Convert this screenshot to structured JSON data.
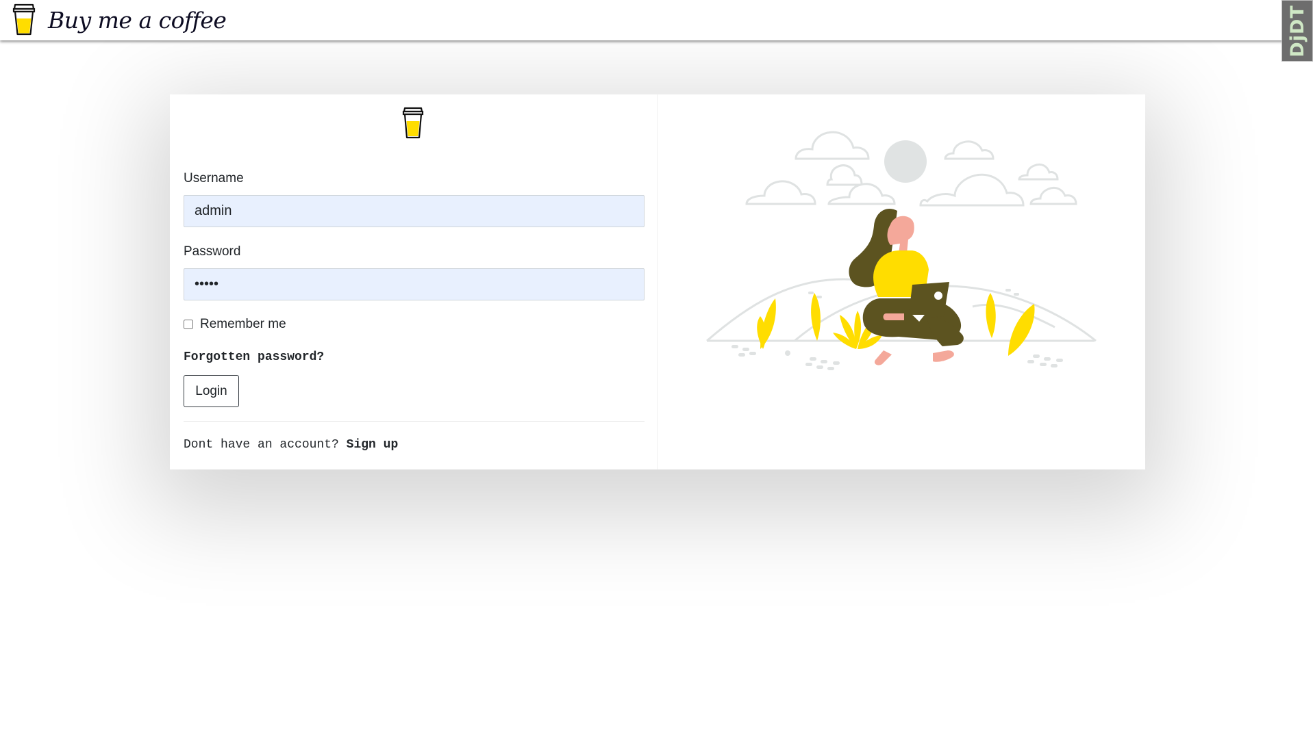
{
  "navbar": {
    "brand_text": "Buy me a coffee",
    "logo_icon": "coffee-cup-icon"
  },
  "debug_toolbar": {
    "label": "DjDT"
  },
  "login_form": {
    "logo_icon": "coffee-cup-icon",
    "username_label": "Username",
    "username_value": "admin",
    "password_label": "Password",
    "password_value": "admin",
    "remember_label": "Remember me",
    "remember_checked": false,
    "forgot_link": "Forgotten password?",
    "login_button": "Login",
    "signup_prefix": "Dont have an account?",
    "signup_link": "Sign up"
  },
  "illustration": {
    "description_icon": "woman-with-laptop-illustration",
    "colors": {
      "yellow": "#ffdd00",
      "olive": "#5c5320",
      "skin": "#f4a89a",
      "gray": "#e0e3e3"
    }
  },
  "theme": {
    "accent": "#ffdd00",
    "input_bg": "#e8f0fe",
    "text": "#212529"
  }
}
